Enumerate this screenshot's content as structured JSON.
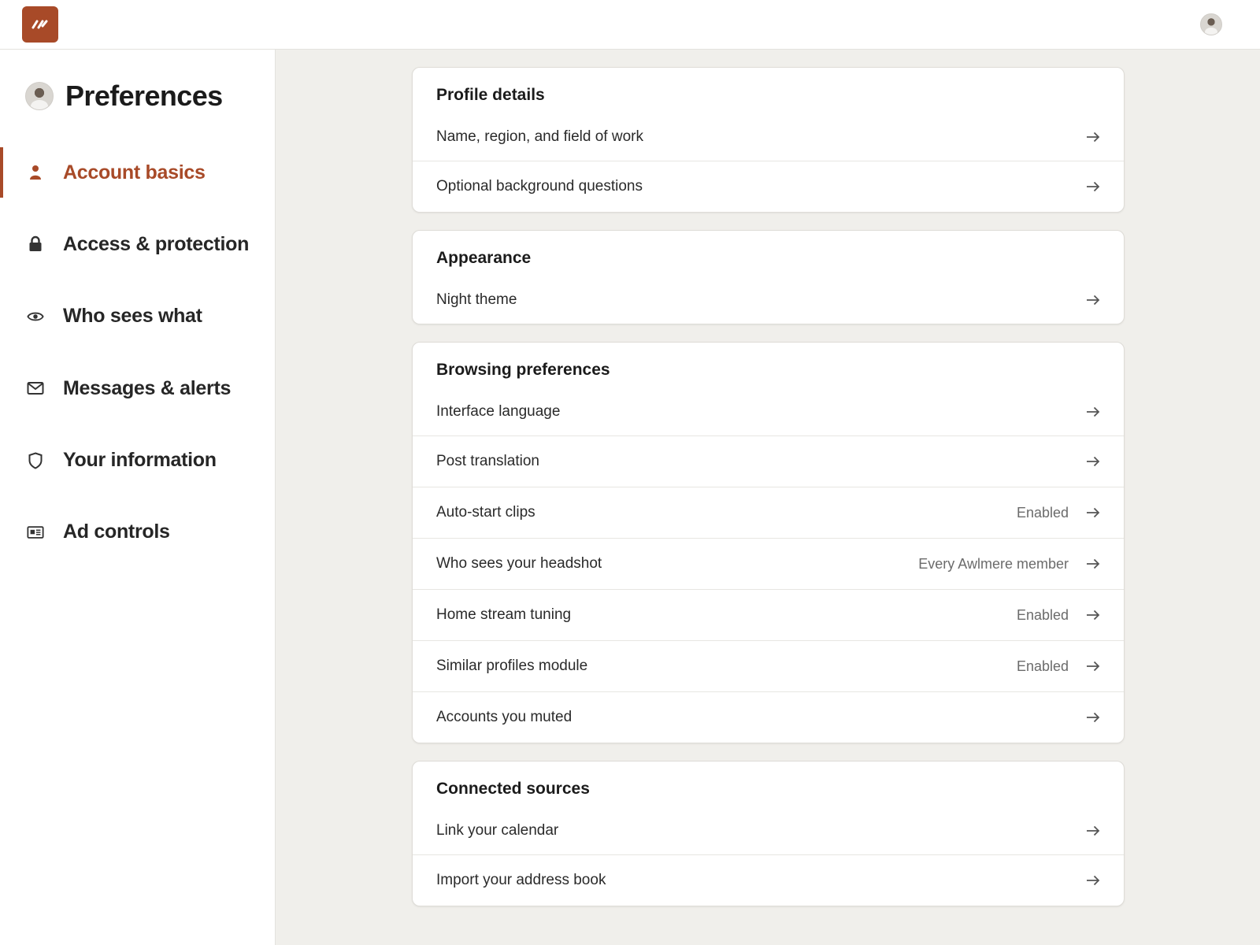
{
  "header": {
    "logo_icon": "brand-logo-icon",
    "accent_color": "#a84a28"
  },
  "sidebar": {
    "title": "Preferences",
    "items": [
      {
        "label": "Account basics",
        "icon": "person-icon",
        "active": true
      },
      {
        "label": "Access & protection",
        "icon": "lock-icon",
        "active": false
      },
      {
        "label": "Who sees what",
        "icon": "eye-icon",
        "active": false
      },
      {
        "label": "Messages & alerts",
        "icon": "envelope-icon",
        "active": false
      },
      {
        "label": "Your information",
        "icon": "shield-icon",
        "active": false
      },
      {
        "label": "Ad controls",
        "icon": "ad-card-icon",
        "active": false
      }
    ]
  },
  "sections": [
    {
      "title": "Profile details",
      "rows": [
        {
          "label": "Name, region, and field of work",
          "value": ""
        },
        {
          "label": "Optional background questions",
          "value": ""
        }
      ]
    },
    {
      "title": "Appearance",
      "rows": [
        {
          "label": "Night theme",
          "value": ""
        }
      ]
    },
    {
      "title": "Browsing preferences",
      "rows": [
        {
          "label": "Interface language",
          "value": ""
        },
        {
          "label": "Post translation",
          "value": ""
        },
        {
          "label": "Auto-start clips",
          "value": "Enabled"
        },
        {
          "label": "Who sees your headshot",
          "value": "Every Awlmere member"
        },
        {
          "label": "Home stream tuning",
          "value": "Enabled"
        },
        {
          "label": "Similar profiles module",
          "value": "Enabled"
        },
        {
          "label": "Accounts you muted",
          "value": ""
        }
      ]
    },
    {
      "title": "Connected sources",
      "rows": [
        {
          "label": "Link your calendar",
          "value": ""
        },
        {
          "label": "Import your address book",
          "value": ""
        }
      ]
    }
  ]
}
